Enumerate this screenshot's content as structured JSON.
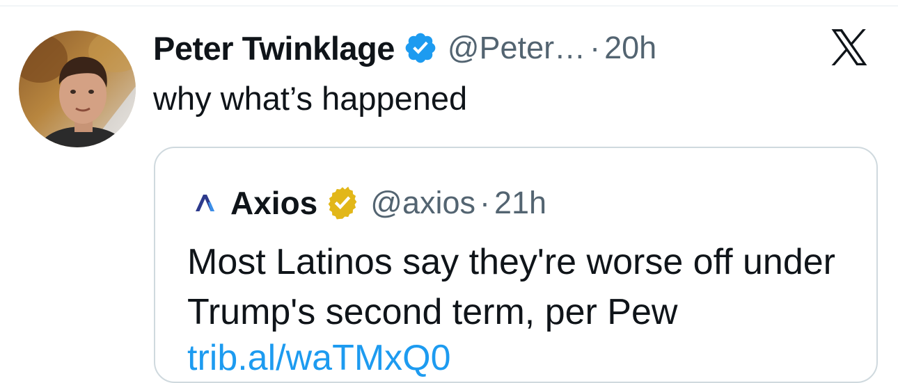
{
  "post": {
    "author_name": "Peter Twinklage",
    "author_handle": "@Peter…",
    "separator": "·",
    "time": "20h",
    "text": "why what’s happened",
    "verified_badge_color": "#1d9bf0"
  },
  "quoted_post": {
    "author_name": "Axios",
    "author_handle": "@axios",
    "separator": "·",
    "time": "21h",
    "text": "Most Latinos say they're worse off under Trump's second term, per Pew",
    "link_text": "trib.al/waTMxQ0",
    "verified_badge_color": "#e2b719"
  },
  "icons": {
    "post_badge": "verified-badge-icon",
    "quote_badge": "gold-verified-badge-icon",
    "brand": "x-logo-icon",
    "quote_logo": "axios-logo-icon"
  }
}
